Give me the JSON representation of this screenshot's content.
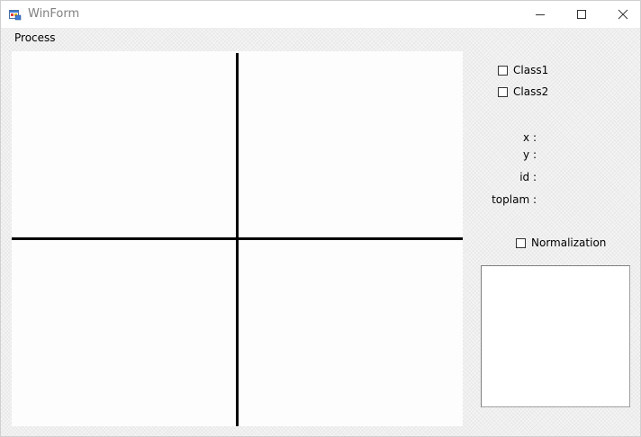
{
  "window": {
    "title": "WinForm"
  },
  "menu": {
    "items": [
      "Process"
    ]
  },
  "checkboxes": {
    "class1": {
      "label": "Class1",
      "checked": false
    },
    "class2": {
      "label": "Class2",
      "checked": false
    },
    "normalization": {
      "label": "Normalization",
      "checked": false
    }
  },
  "info": {
    "x_label": "x :",
    "y_label": "y :",
    "id_label": "id :",
    "toplam_label": "toplam :"
  },
  "output": {
    "text": ""
  },
  "colors": {
    "titlebar": "#ffffff",
    "canvas": "#fdfdfd",
    "axis": "#000000"
  }
}
